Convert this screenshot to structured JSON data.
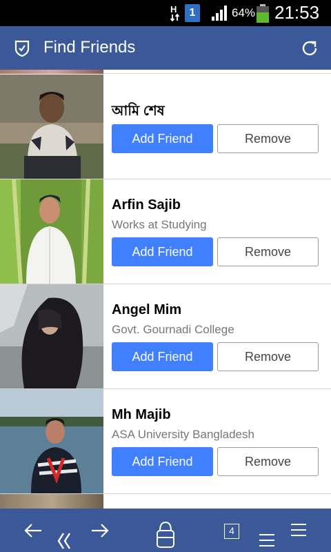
{
  "status_bar": {
    "sim_slot": "1",
    "battery_percent": "64%",
    "battery_level": 0.64,
    "time": "21:53",
    "icons": [
      "data-transfer-icon",
      "sim-icon",
      "signal-icon",
      "battery-icon"
    ]
  },
  "header": {
    "title": "Find Friends",
    "icons": [
      "shield-icon",
      "refresh-icon"
    ]
  },
  "friends": [
    {
      "name": "আমি শেষ",
      "subtitle": "",
      "add_label": "Add Friend",
      "remove_label": "Remove"
    },
    {
      "name": "Arfin Sajib",
      "subtitle": "Works at Studying",
      "add_label": "Add Friend",
      "remove_label": "Remove"
    },
    {
      "name": "Angel Mim",
      "subtitle": "Govt. Gournadi College",
      "add_label": "Add Friend",
      "remove_label": "Remove"
    },
    {
      "name": "Mh Majib",
      "subtitle": "ASA University Bangladesh",
      "add_label": "Add Friend",
      "remove_label": "Remove"
    }
  ],
  "bottom_nav": {
    "tab_count": "4",
    "icons": [
      "back-arrow-icon",
      "rewind-icon",
      "forward-arrow-icon",
      "home-icon",
      "tabs-icon",
      "menu-icon"
    ]
  },
  "colors": {
    "brand": "#3b5998",
    "add_button": "#4080ff",
    "status_bar": "#000000"
  }
}
